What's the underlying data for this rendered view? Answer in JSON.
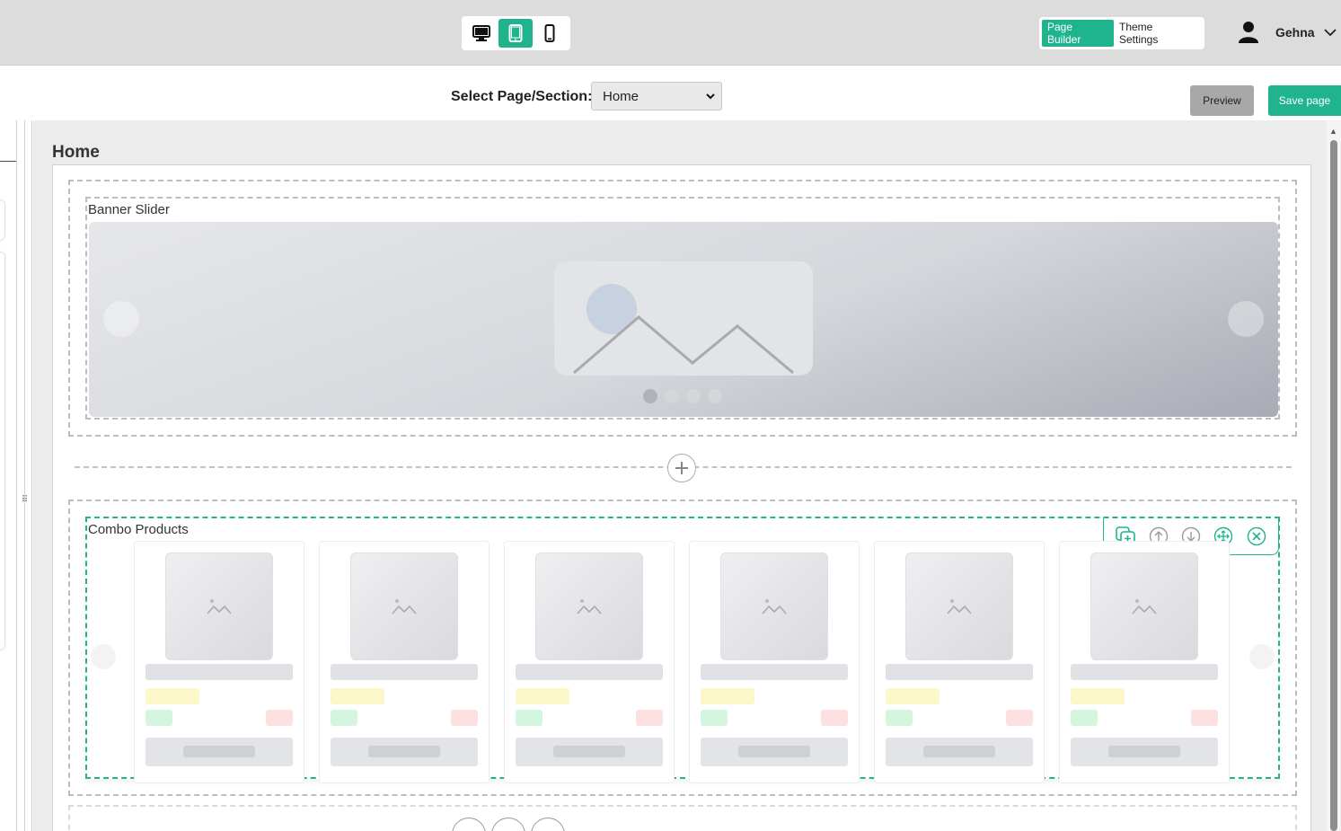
{
  "topbar": {
    "devices": [
      {
        "name": "desktop",
        "icon": "desktop-icon",
        "active": false
      },
      {
        "name": "tablet",
        "icon": "tablet-icon",
        "active": true
      },
      {
        "name": "mobile",
        "icon": "mobile-icon",
        "active": false
      }
    ],
    "modes": {
      "page_builder": "Page Builder",
      "theme_settings": "Theme Settings"
    },
    "user": {
      "name": "Gehna",
      "icon": "user-icon"
    },
    "accent_color": "#1fb38e"
  },
  "subbar": {
    "select_label": "Select Page/Section:",
    "selected_page": "Home",
    "preview_label": "Preview",
    "save_label": "Save page"
  },
  "canvas": {
    "page_title": "Home",
    "sections": [
      {
        "label": "Banner Slider",
        "slides": 4,
        "active_slide": 1
      },
      {
        "label": "Combo Products",
        "cards": 6
      }
    ],
    "toolbar_tools": [
      "duplicate-icon",
      "move-up-icon",
      "move-down-icon",
      "drag-move-icon",
      "delete-icon"
    ]
  }
}
